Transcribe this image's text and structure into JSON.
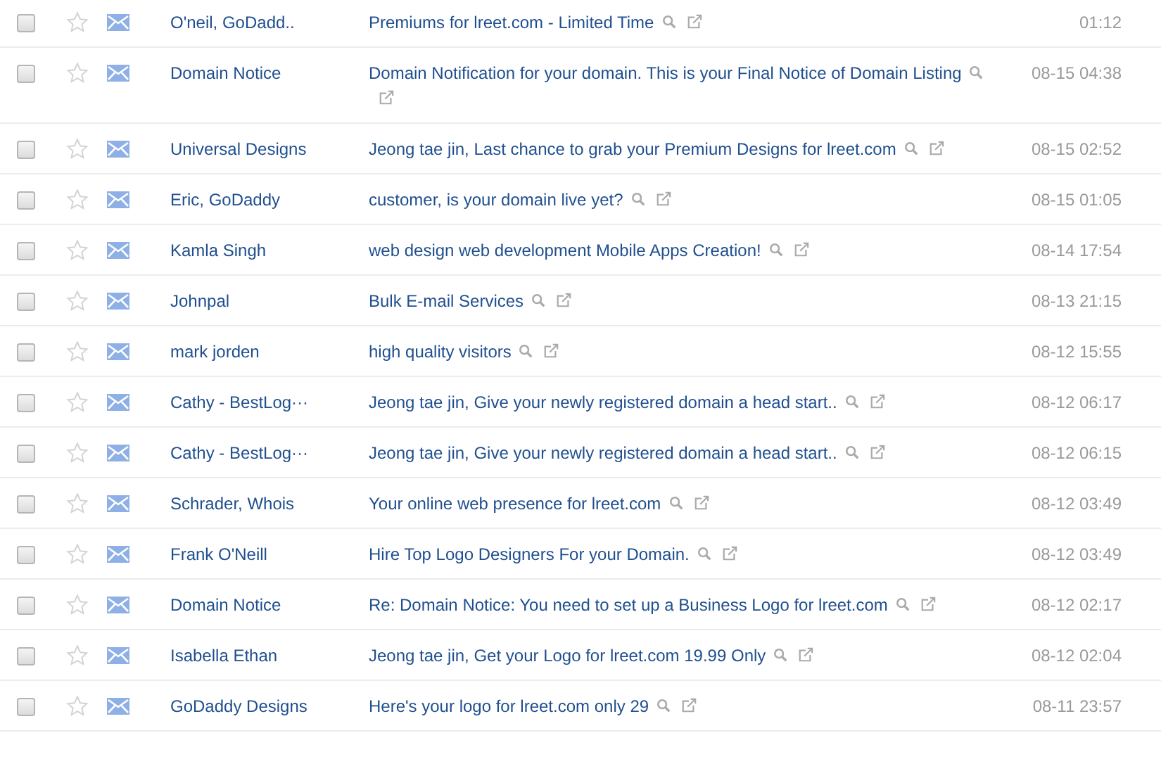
{
  "messages": [
    {
      "checked": false,
      "starred": false,
      "sender": "O'neil, GoDadd..",
      "subject": "Premiums for lreet.com  - Limited Time",
      "date": "01:12"
    },
    {
      "checked": false,
      "starred": false,
      "sender": "Domain Notice",
      "subject": "Domain Notification for your domain. This is your Final Notice of Domain Listing",
      "date": "08-15 04:38"
    },
    {
      "checked": false,
      "starred": false,
      "sender": "Universal Designs",
      "subject": "Jeong tae jin, Last chance to grab your Premium  Designs for lreet.com",
      "date": "08-15 02:52"
    },
    {
      "checked": false,
      "starred": false,
      "sender": "Eric, GoDaddy",
      "subject": "customer, is your domain live yet?",
      "date": "08-15 01:05"
    },
    {
      "checked": false,
      "starred": false,
      "sender": "Kamla Singh",
      "subject": "web design web development Mobile Apps Creation!",
      "date": "08-14 17:54"
    },
    {
      "checked": false,
      "starred": false,
      "sender": "Johnpal",
      "subject": "Bulk E-mail Services",
      "date": "08-13 21:15"
    },
    {
      "checked": false,
      "starred": false,
      "sender": "mark jorden",
      "subject": "high quality visitors",
      "date": "08-12 15:55"
    },
    {
      "checked": false,
      "starred": false,
      "sender": "Cathy - BestLog···",
      "subject": "Jeong tae jin, Give your newly registered domain a head start..",
      "date": "08-12 06:17"
    },
    {
      "checked": false,
      "starred": false,
      "sender": "Cathy - BestLog···",
      "subject": "Jeong tae jin, Give your newly registered domain a head start..",
      "date": "08-12 06:15"
    },
    {
      "checked": false,
      "starred": false,
      "sender": "Schrader, Whois",
      "subject": "Your online web presence for lreet.com",
      "date": "08-12 03:49"
    },
    {
      "checked": false,
      "starred": false,
      "sender": "Frank O'Neill",
      "subject": "Hire Top Logo Designers For your Domain.",
      "date": "08-12 03:49"
    },
    {
      "checked": false,
      "starred": false,
      "sender": "Domain Notice",
      "subject": "Re: Domain Notice: You need to set up a Business Logo for lreet.com",
      "date": "08-12 02:17"
    },
    {
      "checked": false,
      "starred": false,
      "sender": "Isabella Ethan",
      "subject": "Jeong tae jin, Get your Logo for lreet.com  19.99 Only",
      "date": "08-12 02:04"
    },
    {
      "checked": false,
      "starred": false,
      "sender": "GoDaddy Designs",
      "subject": "Here's your logo for lreet.com  only 29",
      "date": "08-11 23:57"
    }
  ]
}
